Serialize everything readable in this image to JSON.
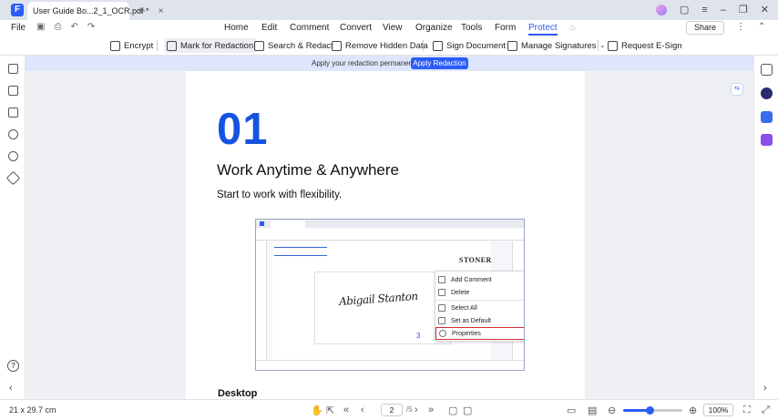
{
  "window": {
    "tab_title": "User Guide Bo...2_1_OCR.pdf *",
    "tab_close": "×",
    "new_tab": "+"
  },
  "menu": {
    "file": "File",
    "tabs": [
      "Home",
      "Edit",
      "Comment",
      "Convert",
      "View",
      "Organize",
      "Tools",
      "Form",
      "Protect"
    ],
    "active_tab": "Protect",
    "share": "Share"
  },
  "toolbar": {
    "encrypt": "Encrypt",
    "mark_for_redaction": "Mark for Redaction",
    "search_redact": "Search & Redact",
    "remove_hidden_data": "Remove Hidden Data",
    "sign_document": "Sign Document",
    "manage_signatures": "Manage Signatures",
    "request_esign": "Request E-Sign"
  },
  "banner": {
    "text": "Apply your redaction permanently.",
    "button": "Apply Redaction"
  },
  "page": {
    "number": "01",
    "heading": "Work Anytime & Anywhere",
    "subheading": "Start to work with flexibility.",
    "section": "Desktop"
  },
  "screenshot": {
    "stoner": "STONER",
    "signature": "Abigail Stanton",
    "page_number": "3",
    "context_menu": [
      "Add Comment",
      "Delete",
      "Select All",
      "Set as Default",
      "Properties"
    ],
    "highlighted_item": "Properties"
  },
  "status": {
    "page_size": "21 x 29.7 cm",
    "current_page": "2",
    "total_pages": "/5",
    "zoom": "100%",
    "zoom_fraction": 0.45
  },
  "colors": {
    "accent": "#2b5cf6",
    "highlight": "#d32f2f"
  }
}
